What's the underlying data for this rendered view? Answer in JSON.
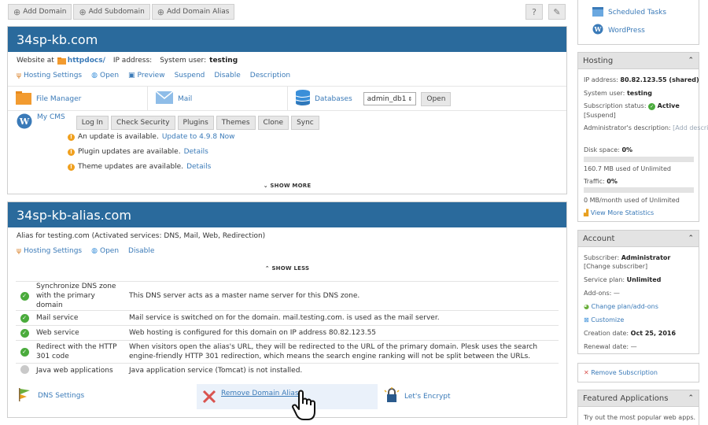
{
  "toolbar": {
    "add_domain": "Add Domain",
    "add_subdomain": "Add Subdomain",
    "add_alias": "Add Domain Alias"
  },
  "domain1": {
    "title": "34sp-kb.com",
    "website_at": "Website at",
    "httpdocs": "httpdocs/",
    "ip_label": "IP address:",
    "sys_user_label": "System user:",
    "sys_user": "testing",
    "actions": [
      "Hosting Settings",
      "Open",
      "Preview",
      "Suspend",
      "Disable",
      "Description"
    ],
    "file_manager": "File Manager",
    "mail": "Mail",
    "databases": "Databases",
    "db_select": "admin_db1",
    "db_open": "Open",
    "mycms": "My CMS",
    "cms_buttons": [
      "Log In",
      "Check Security",
      "Plugins",
      "Themes",
      "Clone",
      "Sync"
    ],
    "warnings": [
      {
        "text": "An update is available.",
        "link": "Update to 4.9.8 Now"
      },
      {
        "text": "Plugin updates are available.",
        "link": "Details"
      },
      {
        "text": "Theme updates are available.",
        "link": "Details"
      }
    ],
    "show_more": "SHOW MORE"
  },
  "domain2": {
    "title": "34sp-kb-alias.com",
    "alias_text": "Alias for testing.com (Activated services: DNS, Mail, Web, Redirection)",
    "actions": [
      "Hosting Settings",
      "Open",
      "Disable"
    ],
    "show_less": "SHOW LESS",
    "services": [
      {
        "status": "on",
        "name": "Synchronize DNS zone with the primary domain",
        "desc": "This DNS server acts as a master name server for this DNS zone."
      },
      {
        "status": "on",
        "name": "Mail service",
        "desc": "Mail service is switched on for the domain. mail.testing.com. is used as the mail server."
      },
      {
        "status": "on",
        "name": "Web service",
        "desc": "Web hosting is configured for this domain on IP address 80.82.123.55"
      },
      {
        "status": "on",
        "name": "Redirect with the HTTP 301 code",
        "desc": "When visitors open the alias's URL, they will be redirected to the URL of the primary domain. Plesk uses the search engine-friendly HTTP 301 redirection, which means the search engine ranking will not be split between the URLs."
      },
      {
        "status": "off",
        "name": "Java web applications",
        "desc": "Java application service (Tomcat) is not installed."
      }
    ],
    "dns_settings": "DNS Settings",
    "remove_alias": "Remove Domain Alias",
    "lets_encrypt": "Let's Encrypt"
  },
  "sidebar": {
    "scheduled_tasks": "Scheduled Tasks",
    "wordpress": "WordPress",
    "hosting": {
      "title": "Hosting",
      "ip_label": "IP address:",
      "ip": "80.82.123.55 (shared)",
      "sys_user_label": "System user:",
      "sys_user": "testing",
      "sub_status_label": "Subscription status:",
      "sub_status": "Active",
      "suspend": "[Suspend]",
      "admin_desc_label": "Administrator's description:",
      "add_desc": "[Add description]",
      "disk_label": "Disk space:",
      "disk_pct": "0%",
      "disk_used": "160.7 MB used of Unlimited",
      "traffic_label": "Traffic:",
      "traffic_pct": "0%",
      "traffic_used": "0 MB/month used of Unlimited",
      "view_stats": "View More Statistics"
    },
    "account": {
      "title": "Account",
      "subscriber_label": "Subscriber:",
      "subscriber": "Administrator",
      "change_sub": "[Change subscriber]",
      "plan_label": "Service plan:",
      "plan": "Unlimited",
      "addons_label": "Add-ons:",
      "addons": "—",
      "change_plan": "Change plan/add-ons",
      "customize": "Customize",
      "created_label": "Creation date:",
      "created": "Oct 25, 2016",
      "renewal_label": "Renewal date:",
      "renewal": "—"
    },
    "remove_subscription": "Remove Subscription",
    "featured": {
      "title": "Featured Applications",
      "text": "Try out the most popular web apps."
    }
  }
}
